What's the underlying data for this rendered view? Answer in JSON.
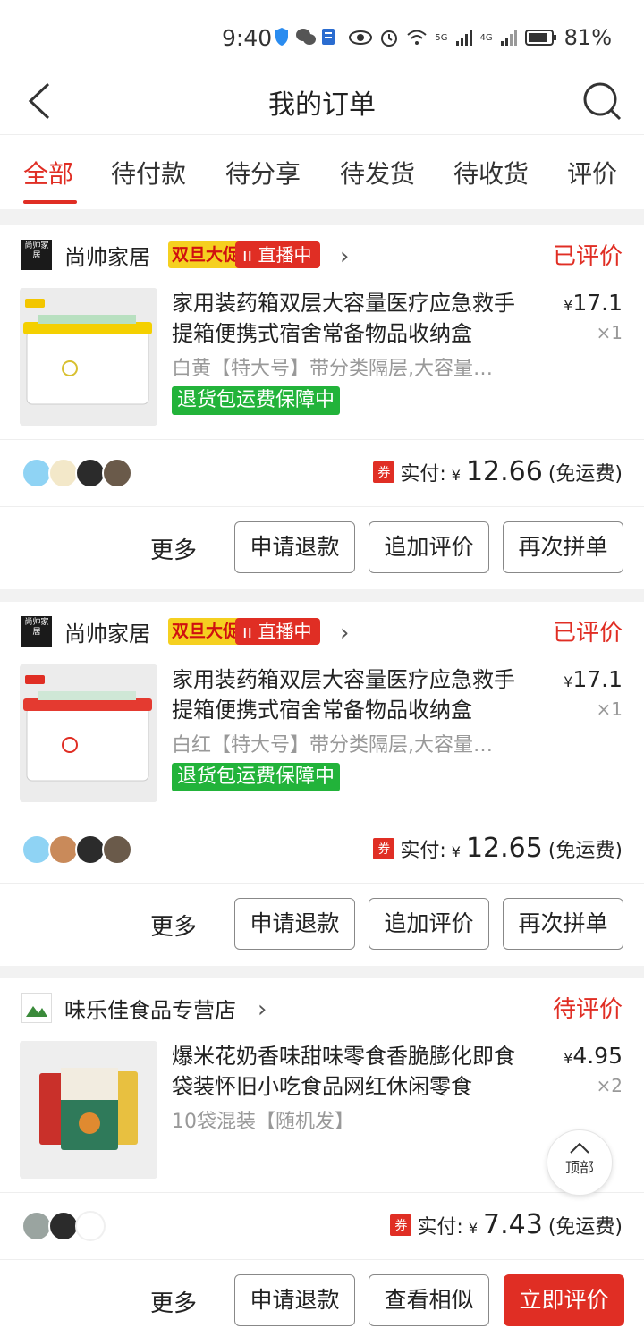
{
  "status_bar": {
    "time": "9:40",
    "battery": "81%",
    "net1": "5G",
    "net2": "4G"
  },
  "header": {
    "title": "我的订单"
  },
  "tabs": [
    {
      "label": "全部",
      "active": true
    },
    {
      "label": "待付款"
    },
    {
      "label": "待分享"
    },
    {
      "label": "待发货"
    },
    {
      "label": "待收货"
    },
    {
      "label": "评价"
    }
  ],
  "orders": [
    {
      "shop_name": "尚帅家居",
      "logo_text": "尚帅家居",
      "promo_badge": "双旦大促",
      "live_badge": "直播中",
      "status": "已评价",
      "product_title": "家用装药箱双层大容量医疗应急救手提箱便携式宿舍常备物品收纳盒",
      "spec": "白黄【特大号】带分类隔层,大容量…",
      "guarantee": "退货包运费保障中",
      "price": "17.1",
      "qty": "×1",
      "pay_label": "实付:",
      "coupon": "券",
      "paid": "12.66",
      "shipping": "(免运费)",
      "more": "更多",
      "buttons": [
        "申请退款",
        "追加评价",
        "再次拼单"
      ]
    },
    {
      "shop_name": "尚帅家居",
      "logo_text": "尚帅家居",
      "promo_badge": "双旦大促",
      "live_badge": "直播中",
      "status": "已评价",
      "product_title": "家用装药箱双层大容量医疗应急救手提箱便携式宿舍常备物品收纳盒",
      "spec": "白红【特大号】带分类隔层,大容量…",
      "guarantee": "退货包运费保障中",
      "price": "17.1",
      "qty": "×1",
      "pay_label": "实付:",
      "coupon": "券",
      "paid": "12.65",
      "shipping": "(免运费)",
      "more": "更多",
      "buttons": [
        "申请退款",
        "追加评价",
        "再次拼单"
      ]
    },
    {
      "shop_name": "味乐佳食品专营店",
      "status": "待评价",
      "product_title": "爆米花奶香味甜味零食香脆膨化即食袋装怀旧小吃食品网红休闲零食",
      "spec": "10袋混装【随机发】",
      "price": "4.95",
      "qty": "×2",
      "pay_label": "实付:",
      "coupon": "券",
      "paid": "7.43",
      "shipping": "(免运费)",
      "more": "更多",
      "buttons": [
        "申请退款",
        "查看相似",
        "立即评价"
      ]
    }
  ],
  "currency": "¥",
  "back_to_top": "顶部",
  "colors": {
    "accent": "#e02e24",
    "guarantee": "#22b33a"
  }
}
